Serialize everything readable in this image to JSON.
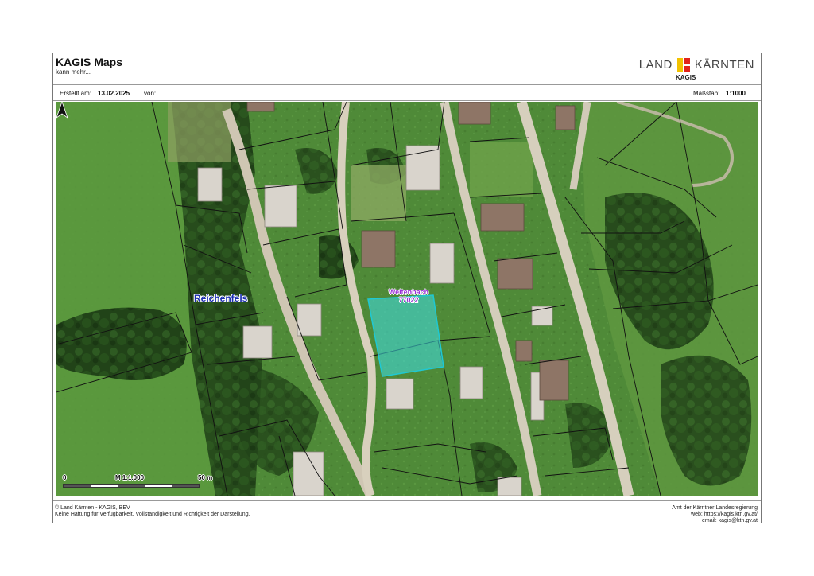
{
  "header": {
    "title": "KAGIS Maps",
    "subtitle": "kann mehr...",
    "brand_left": "LAND",
    "brand_right": "KÄRNTEN",
    "brand_sub": "KAGIS",
    "brand_colors": {
      "yellow": "#f2c200",
      "red": "#e2231a"
    }
  },
  "meta": {
    "created_label": "Erstellt am:",
    "created_value": "13.02.2025",
    "by_label": "von:",
    "scale_label": "Maßstab:",
    "scale_value": "1:1000"
  },
  "map": {
    "place_label": "Reichenfels",
    "parcel_label_line1": "Weitenbach",
    "parcel_label_line2": "77022",
    "highlight_color": "#3fe0e8",
    "north_arrow_icon": "north-arrow-icon"
  },
  "scalebar": {
    "zero": "0",
    "middle": "M 1:1.000",
    "end": "50 m"
  },
  "footer": {
    "left_line1": "© Land Kärnten - KAGIS, BEV",
    "left_line2": "Keine Haftung für Verfügbarkeit, Vollständigkeit und Richtigkeit der Darstellung.",
    "right_line1": "Amt der Kärntner Landesregierung",
    "right_line2": "web: https://kagis.ktn.gv.at/",
    "right_line3": "email: kagis@ktn.gv.at"
  }
}
